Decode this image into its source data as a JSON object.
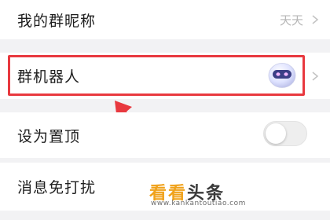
{
  "rows": [
    {
      "label": "我的群昵称",
      "value": "天天"
    },
    {
      "label": "群机器人"
    },
    {
      "label": "设为置顶",
      "toggle": false
    },
    {
      "label": "消息免打扰"
    }
  ],
  "colors": {
    "highlight": "#e8393f",
    "background": "#f2f2f4",
    "watermark_accent": "#f0a21c"
  },
  "icons": {
    "chevron": "chevron-right-icon",
    "robot": "robot-avatar-icon",
    "annotation": "red-arrow-icon"
  },
  "watermark": {
    "brand_part1": "看看",
    "brand_part2": "头条",
    "url": "www.kankantoutiao.com"
  }
}
